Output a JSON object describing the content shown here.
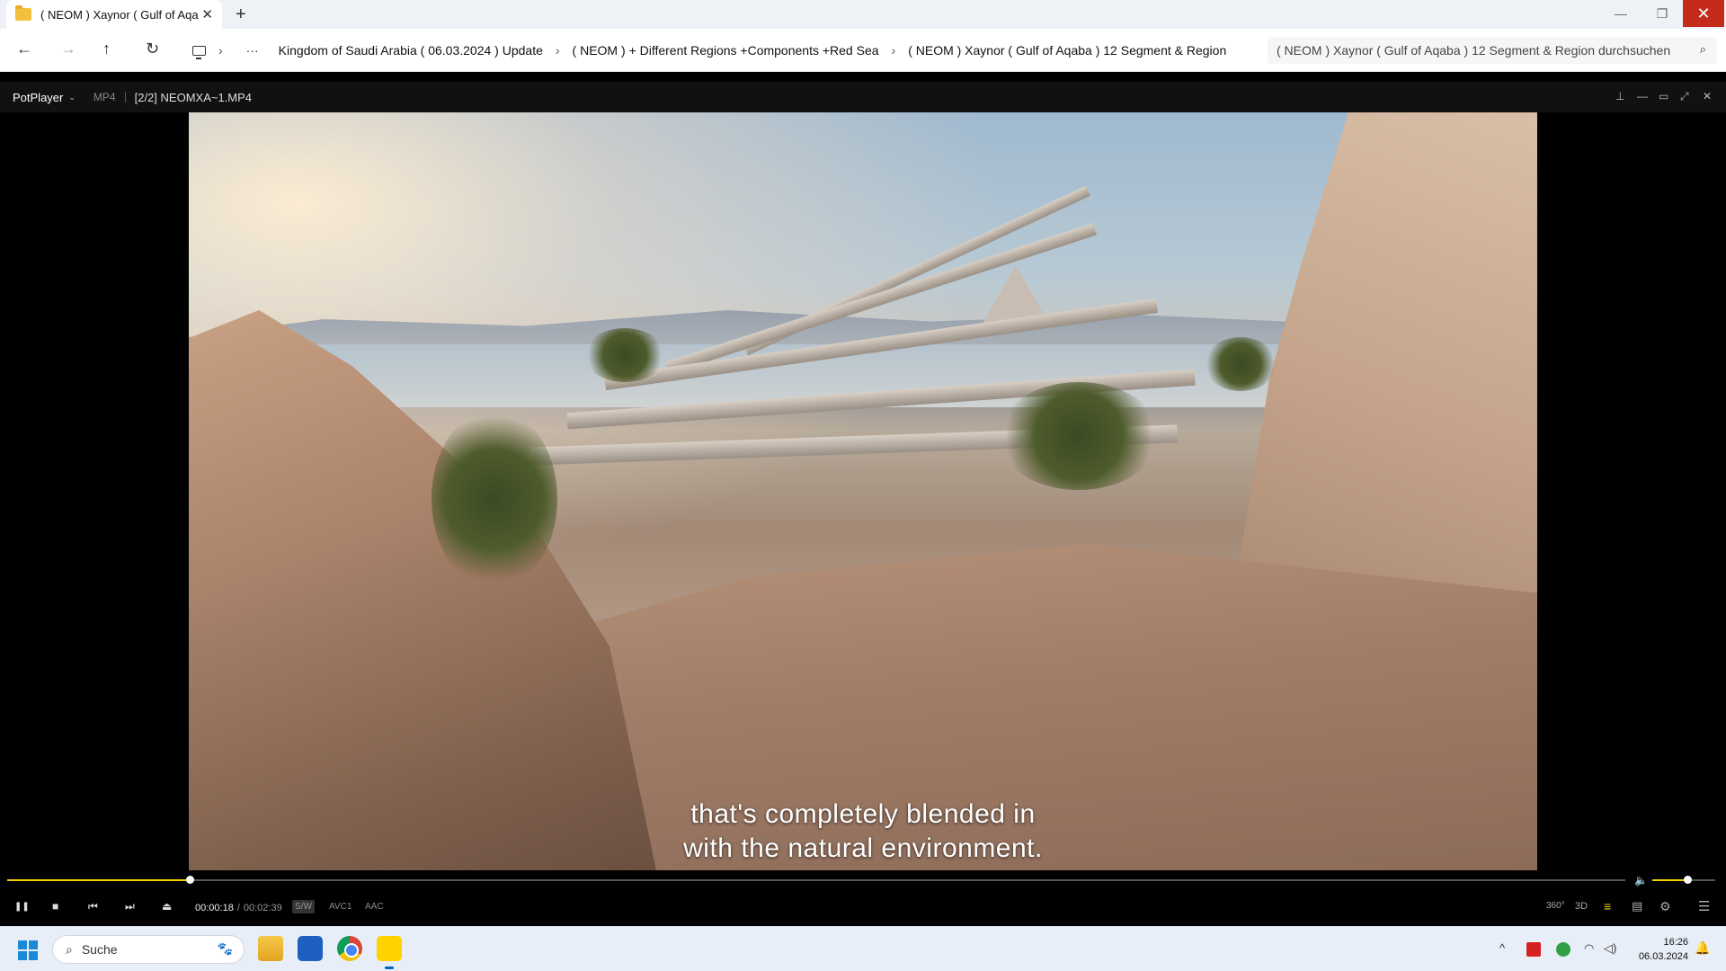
{
  "explorer": {
    "tab_title": "( NEOM ) Xaynor ( Gulf of Aqa",
    "tab_close": "✕",
    "new_tab": "+",
    "window_controls": {
      "minimize": "—",
      "maximize": "❐",
      "close": "✕"
    },
    "nav": {
      "back": "←",
      "forward": "→",
      "up": "↑",
      "refresh": "↻"
    },
    "breadcrumbs": [
      "Kingdom of Saudi Arabia ( 06.03.2024 ) Update",
      "( NEOM ) + Different Regions +Components +Red Sea",
      "( NEOM ) Xaynor ( Gulf of Aqaba ) 12 Segment & Region"
    ],
    "crumb_sep": "›",
    "more": "···",
    "search_placeholder": "( NEOM ) Xaynor ( Gulf of Aqaba ) 12 Segment & Region durchsuchen",
    "search_icon": "⌕"
  },
  "player": {
    "brand": "PotPlayer",
    "brand_caret": "⌄",
    "format": "MP4",
    "filename": "[2/2] NEOMXA~1.MP4",
    "title_controls": {
      "pin": "⊥",
      "minimize": "—",
      "maximize": "▭",
      "fullscreen": "⤢",
      "close": "✕"
    },
    "subtitle_line1": "that's completely blended in",
    "subtitle_line2": "with the natural environment.",
    "progress_fraction": 0.113,
    "volume_fraction": 0.55,
    "time_current": "00:00:18",
    "time_sep": "/",
    "time_total": "00:02:39",
    "tags": {
      "sw": "S/W",
      "video_codec": "AVC1",
      "audio_codec": "AAC"
    },
    "controls": {
      "pause": "❚❚",
      "stop": "■",
      "prev": "⏮",
      "next": "⏭",
      "eject": "⏏"
    },
    "right_controls": {
      "r360": "360°",
      "r3d": "3D",
      "playlist": "≡",
      "panel": "▤",
      "settings": "⚙",
      "menu": "☰"
    },
    "volume_icon": "🔈",
    "colors": {
      "accent": "#f0d000"
    }
  },
  "taskbar": {
    "search_label": "Suche",
    "search_icon": "⌕",
    "tray_chevron": "^",
    "wifi": "◠",
    "speaker": "◁)",
    "time": "16:26",
    "date": "06.03.2024",
    "bell": "🔔"
  }
}
